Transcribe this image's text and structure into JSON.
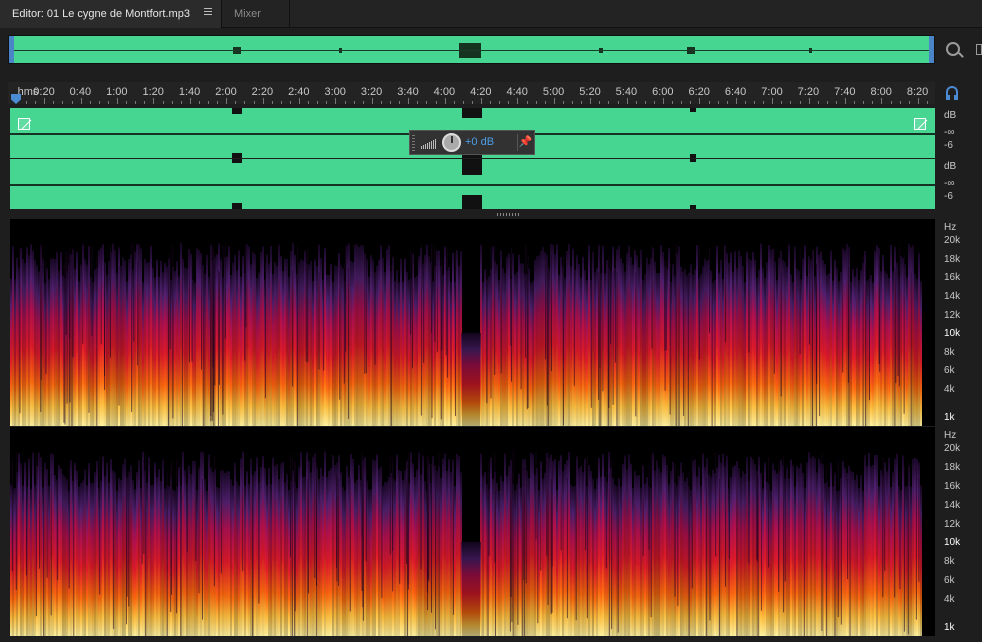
{
  "tabs": {
    "editor": "Editor: 01 Le cygne de Montfort.mp3",
    "mixer": "Mixer"
  },
  "ruler": {
    "unit": "hms",
    "ticks": [
      "0:20",
      "0:40",
      "1:00",
      "1:20",
      "1:40",
      "2:00",
      "2:20",
      "2:40",
      "3:00",
      "3:20",
      "3:40",
      "4:00",
      "4:20",
      "4:40",
      "5:00",
      "5:20",
      "5:40",
      "6:00",
      "6:20",
      "6:40",
      "7:00",
      "7:20",
      "7:40",
      "8:00",
      "8:20"
    ]
  },
  "hud": {
    "volume_value": "+0 dB"
  },
  "db_scale": {
    "unit": "dB",
    "labels": [
      "dB",
      "-∞",
      "-6"
    ]
  },
  "hz_scale": {
    "unit": "Hz",
    "labels": [
      "20k",
      "18k",
      "16k",
      "14k",
      "12k",
      "10k",
      "8k",
      "6k",
      "4k",
      "1k"
    ]
  },
  "colors": {
    "waveform": "#46d692",
    "accent": "#4b8bd4",
    "spectrogram_low": "#ffd060",
    "spectrogram_mid": "#e02030",
    "spectrogram_high": "#502070"
  },
  "icons": [
    "menu-icon",
    "zoom-icon",
    "panel-icon",
    "headphone-icon",
    "fade-in-icon",
    "fade-out-icon",
    "knob-icon",
    "pin-icon"
  ]
}
